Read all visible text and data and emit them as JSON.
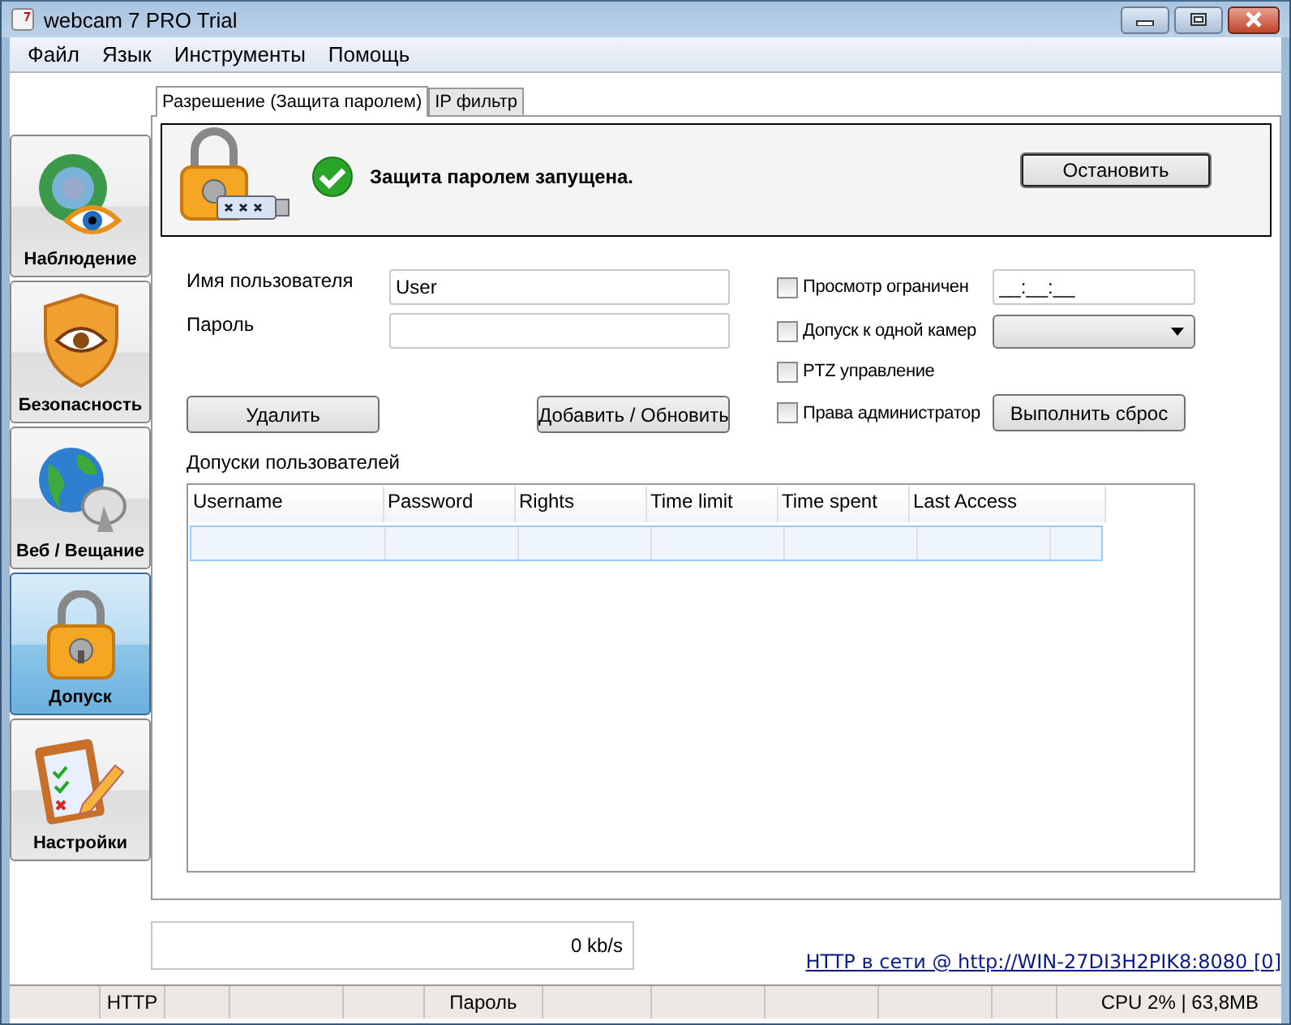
{
  "window": {
    "title": "webcam 7 PRO Trial"
  },
  "menu": [
    "Файл",
    "Язык",
    "Инструменты",
    "Помощь"
  ],
  "sidebar": {
    "items": [
      {
        "label": "Наблюдение",
        "kind": "watch",
        "selected": false
      },
      {
        "label": "Безопасность",
        "kind": "security",
        "selected": false
      },
      {
        "label": "Веб / Вещание",
        "kind": "web",
        "selected": false
      },
      {
        "label": "Допуск",
        "kind": "access",
        "selected": true
      },
      {
        "label": "Настройки",
        "kind": "settings",
        "selected": false
      }
    ]
  },
  "tabs": [
    {
      "label": "Разрешение (Защита паролем)",
      "selected": true
    },
    {
      "label": "IP фильтр",
      "selected": false
    }
  ],
  "status_panel": {
    "message": "Защита паролем запущена.",
    "button": "Остановить"
  },
  "form": {
    "username_label": "Имя пользователя",
    "username_value": "User",
    "password_label": "Пароль",
    "delete_button": "Удалить",
    "add_button": "Добавить / Обновить",
    "options": [
      {
        "label": "Просмотр ограничен",
        "checked": false,
        "kind": "time",
        "value": "__:__:__"
      },
      {
        "label": "Допуск к одной камер",
        "checked": false,
        "kind": "dropdown"
      },
      {
        "label": "PTZ управление",
        "checked": false,
        "kind": "none"
      },
      {
        "label": "Права администратор",
        "checked": false,
        "kind": "button",
        "button": "Выполнить сброс"
      }
    ]
  },
  "table": {
    "title": "Допуски пользователей",
    "columns": [
      "Username",
      "Password",
      "Rights",
      "Time limit",
      "Time spent",
      "Last Access"
    ]
  },
  "speed": "0 kb/s",
  "server_link": "HTTP в сети @ http://WIN-27DI3H2PIK8:8080 [0]",
  "status_bar": {
    "protocol": "HTTP",
    "mode": "Пароль",
    "resources": "CPU 2% | 63,8MB"
  }
}
